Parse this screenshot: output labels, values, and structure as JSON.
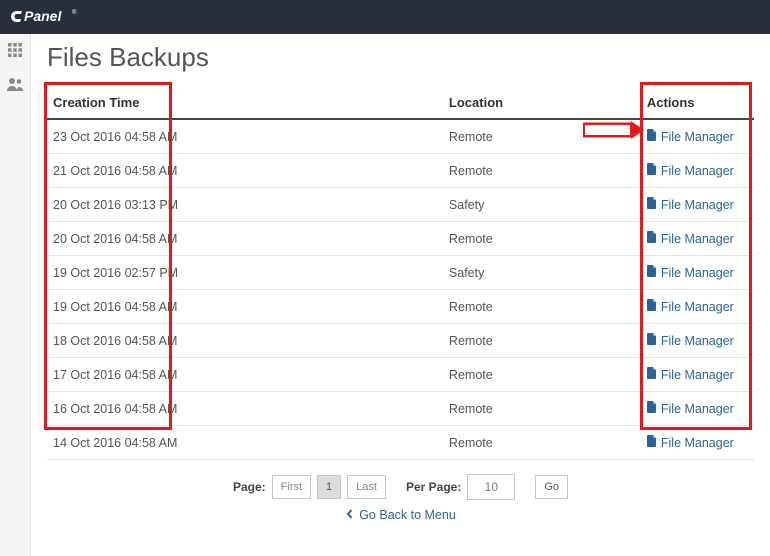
{
  "header": {
    "brand": "cPanel"
  },
  "page": {
    "title": "Files Backups"
  },
  "table": {
    "headers": {
      "creation_time": "Creation Time",
      "location": "Location",
      "actions": "Actions"
    },
    "action_label": "File Manager",
    "rows": [
      {
        "creation_time": "23 Oct 2016 04:58 AM",
        "location": "Remote"
      },
      {
        "creation_time": "21 Oct 2016 04:58 AM",
        "location": "Remote"
      },
      {
        "creation_time": "20 Oct 2016 03:13 PM",
        "location": "Safety"
      },
      {
        "creation_time": "20 Oct 2016 04:58 AM",
        "location": "Remote"
      },
      {
        "creation_time": "19 Oct 2016 02:57 PM",
        "location": "Safety"
      },
      {
        "creation_time": "19 Oct 2016 04:58 AM",
        "location": "Remote"
      },
      {
        "creation_time": "18 Oct 2016 04:58 AM",
        "location": "Remote"
      },
      {
        "creation_time": "17 Oct 2016 04:58 AM",
        "location": "Remote"
      },
      {
        "creation_time": "16 Oct 2016 04:58 AM",
        "location": "Remote"
      },
      {
        "creation_time": "14 Oct 2016 04:58 AM",
        "location": "Remote"
      }
    ]
  },
  "pager": {
    "page_label": "Page:",
    "first": "First",
    "current": "1",
    "last": "Last",
    "per_page_label": "Per Page:",
    "per_page_value": "10",
    "go": "Go"
  },
  "footer": {
    "back": "Go Back to Menu"
  }
}
